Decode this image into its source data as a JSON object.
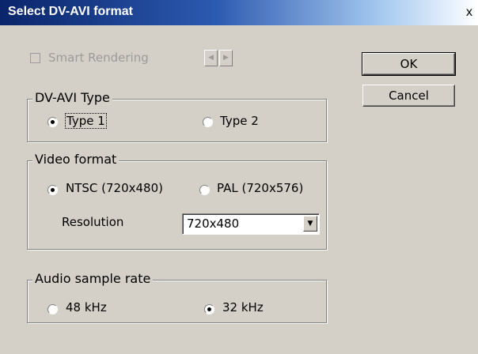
{
  "window": {
    "title": "Select DV-AVI format",
    "close_glyph": "x"
  },
  "smart_rendering": {
    "label": "Smart Rendering",
    "checked": false,
    "disabled": true,
    "prev_glyph": "◀",
    "next_glyph": "▶"
  },
  "buttons": {
    "ok_label": "OK",
    "cancel_label": "Cancel"
  },
  "dvavi_type": {
    "title": "DV-AVI Type",
    "options": [
      {
        "label": "Type 1",
        "selected": true
      },
      {
        "label": "Type 2",
        "selected": false
      }
    ]
  },
  "video_format": {
    "title": "Video format",
    "options": [
      {
        "label": "NTSC (720x480)",
        "selected": true
      },
      {
        "label": "PAL (720x576)",
        "selected": false
      }
    ],
    "resolution_label": "Resolution",
    "resolution_value": "720x480",
    "dropdown_glyph": "▼"
  },
  "audio_sample_rate": {
    "title": "Audio sample rate",
    "options": [
      {
        "label": "48 kHz",
        "selected": false
      },
      {
        "label": "32 kHz",
        "selected": true
      }
    ]
  }
}
